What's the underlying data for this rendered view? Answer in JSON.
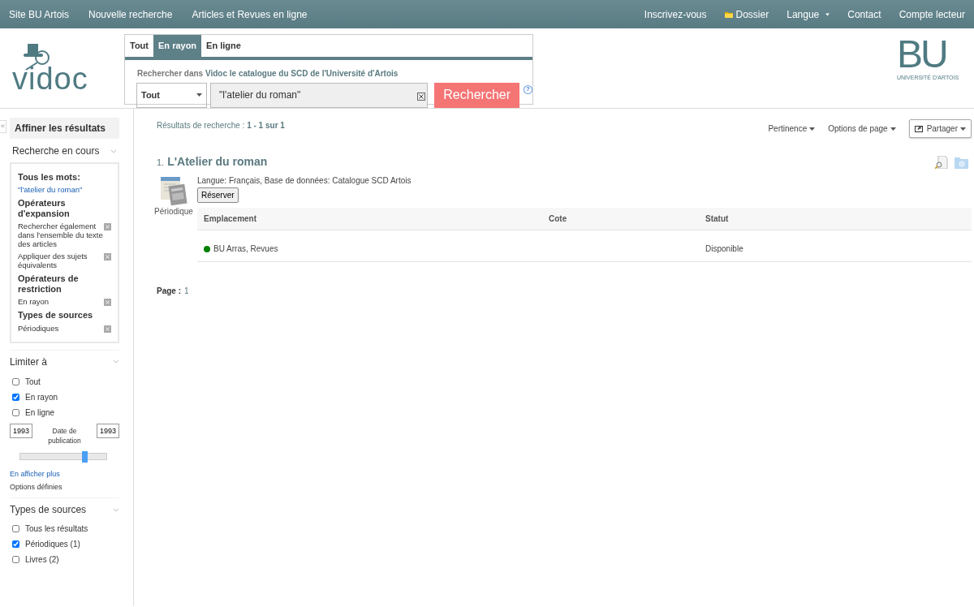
{
  "top_nav": {
    "left": [
      {
        "label": "Site BU Artois"
      },
      {
        "label": "Nouvelle recherche"
      },
      {
        "label": "Articles et Revues en ligne"
      }
    ],
    "right": [
      {
        "label": "Inscrivez-vous",
        "kind": "link"
      },
      {
        "label": "Dossier",
        "kind": "folder"
      },
      {
        "label": "Langue",
        "kind": "dropdown"
      },
      {
        "label": "Contact",
        "kind": "link"
      },
      {
        "label": "Compte lecteur",
        "kind": "link"
      }
    ]
  },
  "logo": {
    "text": "vidoc"
  },
  "bu_logo": {
    "text": "BU",
    "subtitle": "UNIVERSITÉ D'ARTOIS"
  },
  "search": {
    "tabs": [
      {
        "label": "Tout",
        "selected": false
      },
      {
        "label": "En rayon",
        "selected": true
      },
      {
        "label": "En ligne",
        "selected": false
      }
    ],
    "prompt": "Rechercher dans **Vidoc le catalogue du SCD de l'Université d'Artois**",
    "field_select": "Tout",
    "query": "\"l'atelier du roman\"",
    "button": "Rechercher",
    "help": "?"
  },
  "sidebar": {
    "collapse": "«",
    "title": "Affiner les résultats",
    "current_search": {
      "heading": "Recherche en cours",
      "groups": [
        {
          "heading": "Tous les mots:",
          "items": [
            {
              "label": "\"l'atelier du roman\"",
              "kind": "link"
            }
          ]
        },
        {
          "heading": "Opérateurs d'expansion",
          "items": [
            {
              "label": "Rechercher également dans l'ensemble du texte des articles",
              "kind": "filter"
            },
            {
              "label": "Appliquer des sujets équivalents",
              "kind": "filter"
            }
          ]
        },
        {
          "heading": "Opérateurs de restriction",
          "items": [
            {
              "label": "En rayon",
              "kind": "filter"
            }
          ]
        },
        {
          "heading": "Types de sources",
          "items": [
            {
              "label": "Périodiques",
              "kind": "filter"
            }
          ]
        }
      ]
    },
    "limit": {
      "heading": "Limiter à",
      "options": [
        {
          "label": "Tout",
          "checked": false
        },
        {
          "label": "En rayon",
          "checked": true
        },
        {
          "label": "En ligne",
          "checked": false
        }
      ],
      "date_from": "1993",
      "date_label": "Date de publication",
      "date_to": "1993",
      "slider": {
        "level": 0.75
      },
      "more_link": "En afficher plus",
      "defined_options": "Options définies"
    },
    "source_types": {
      "heading": "Types de sources",
      "options": [
        {
          "label": "Tous les résultats",
          "checked": false
        },
        {
          "label": "Périodiques (1)",
          "checked": true
        },
        {
          "label": "Livres (2)",
          "checked": false
        }
      ]
    }
  },
  "results": {
    "summary": "Résultats de recherche : **1 - 1 sur 1**",
    "sort": "Pertinence",
    "page_options": "Options de page",
    "share": "Partager",
    "items": [
      {
        "number": "1.",
        "title": "L'Atelier du roman",
        "type": "Périodique",
        "meta": "Langue: Français, Base de données: Catalogue SCD Artois",
        "action": "Réserver",
        "table": {
          "columns": [
            "Emplacement",
            "Cote",
            "Statut"
          ],
          "rows": [
            {
              "cells": [
                "BU Arras, Revues",
                "",
                "Disponible"
              ],
              "color": "#008000"
            }
          ]
        }
      }
    ],
    "page_label": "Page :",
    "page": "1"
  }
}
